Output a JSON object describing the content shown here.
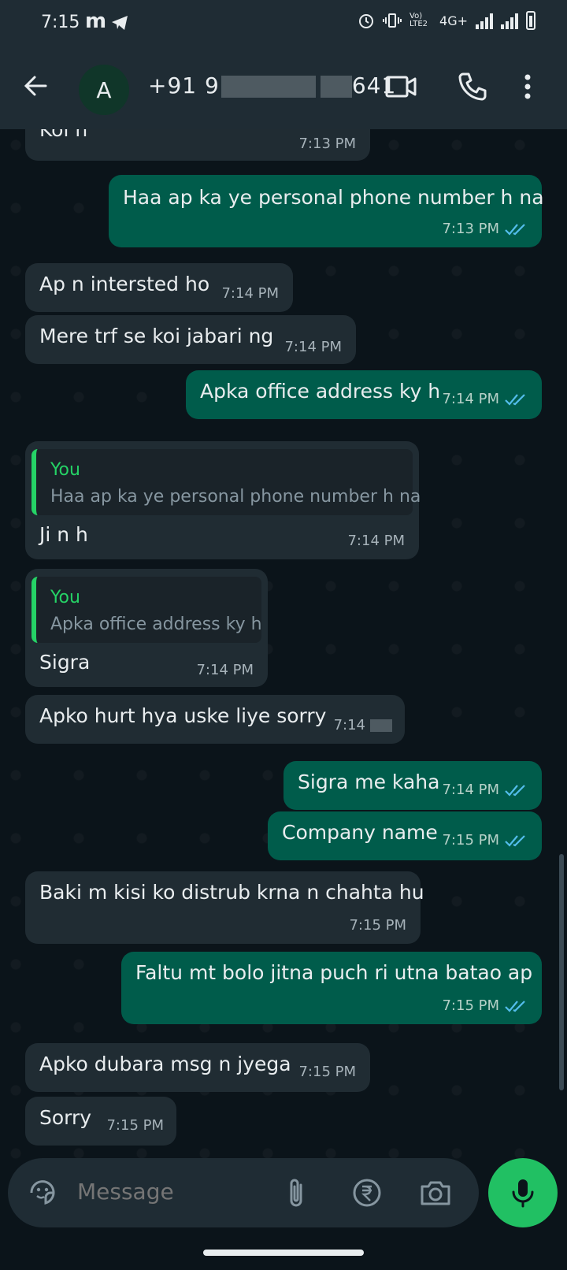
{
  "status_bar": {
    "time": "7:15",
    "notif_m": "m",
    "network": "4G+",
    "volte": "Vo) LTE2"
  },
  "header": {
    "avatar_letter": "A",
    "contact_prefix": "+91 9",
    "contact_suffix": "641"
  },
  "messages": [
    {
      "dir": "in",
      "text": "Koi n",
      "time": "7:13 PM"
    },
    {
      "dir": "out",
      "text": "Haa ap ka ye personal phone number h na",
      "time": "7:13 PM"
    },
    {
      "dir": "in",
      "text": "Ap n intersted ho",
      "time": "7:14 PM"
    },
    {
      "dir": "in",
      "text": "Mere trf se koi jabari ng",
      "time": "7:14 PM"
    },
    {
      "dir": "out",
      "text": "Apka office address ky h",
      "time": "7:14 PM"
    },
    {
      "dir": "in",
      "reply_who": "You",
      "reply_text": "Haa ap ka ye personal phone number h na",
      "text": "Ji n h",
      "time": "7:14 PM"
    },
    {
      "dir": "in",
      "reply_who": "You",
      "reply_text": "Apka office address ky h",
      "text": "Sigra",
      "time": "7:14 PM"
    },
    {
      "dir": "in",
      "text": "Apko hurt hya uske liye sorry",
      "time": "7:14"
    },
    {
      "dir": "out",
      "text": "Sigra me kaha",
      "time": "7:14 PM"
    },
    {
      "dir": "out",
      "text": "Company name",
      "time": "7:15 PM"
    },
    {
      "dir": "in",
      "text": "Baki m kisi ko distrub krna n chahta hu",
      "time": "7:15 PM"
    },
    {
      "dir": "out",
      "text": "Faltu mt bolo jitna puch ri utna batao ap",
      "time": "7:15 PM"
    },
    {
      "dir": "in",
      "text": "Apko dubara msg n jyega",
      "time": "7:15 PM"
    },
    {
      "dir": "in",
      "text": "Sorry",
      "time": "7:15 PM"
    }
  ],
  "composer": {
    "placeholder": "Message"
  },
  "colors": {
    "incoming": "#202c33",
    "outgoing": "#005c4b",
    "accent": "#25d366",
    "read_tick": "#53bdeb"
  }
}
